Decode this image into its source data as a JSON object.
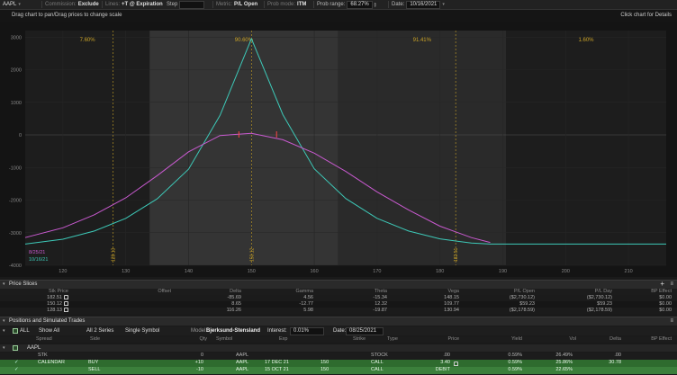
{
  "colors": {
    "expiration_curve": "#3dc9b8",
    "date_curve": "#c95ad0",
    "marker": "#c9a227",
    "strike_marker": "#ff4444",
    "green_row": "#2e6b2e"
  },
  "toolbar": {
    "symbol": "AAPL",
    "commission_label": "Commission:",
    "commission_value": "Exclude",
    "lines_label": "Lines:",
    "lines_value": "+T @ Expiration",
    "step_label": "Step",
    "step_value": "",
    "metric_label": "Metric:",
    "metric_value": "P/L Open",
    "prob_mode_label": "Prob mode:",
    "prob_mode_value": "ITM",
    "prob_range_label": "Prob range:",
    "prob_range_value": "68.27%",
    "date_label": "Date:",
    "date_value": "10/16/2021"
  },
  "hints": {
    "drag": "Drag chart to pan/Drag prices to change scale",
    "click": "Click chart for Details"
  },
  "chart_data": {
    "type": "line",
    "xlim": [
      114,
      216
    ],
    "ylim": [
      -4000,
      3200
    ],
    "x_ticks": [
      120,
      130,
      140,
      150,
      160,
      170,
      180,
      190,
      200,
      210
    ],
    "y_ticks": [
      3000,
      2000,
      1000,
      0,
      -1000,
      -2000,
      -3000,
      -4000
    ],
    "y_tick_labels": [
      "3000",
      "2000",
      "1000",
      "0",
      "-1000",
      "-2000",
      "-3000",
      "-4000"
    ],
    "zones": [
      {
        "from": 114,
        "to": 133.8,
        "label": "7.60%"
      },
      {
        "from": 133.8,
        "to": 163.8,
        "label": "90.60%"
      },
      {
        "from": 163.8,
        "to": 190.5,
        "label": "91.41%"
      },
      {
        "from": 190.5,
        "to": 216,
        "label": "1.60%"
      }
    ],
    "vlines": [
      {
        "x": 128,
        "label": "128.13"
      },
      {
        "x": 150,
        "label": "150.12"
      },
      {
        "x": 182.5,
        "label": "182.51"
      }
    ],
    "strike_markers": [
      {
        "x": 148,
        "y": 0
      },
      {
        "x": 154,
        "y": 0
      }
    ],
    "series": [
      {
        "name": "10/16/21",
        "x": [
          114,
          120,
          125,
          130,
          135,
          140,
          145,
          150,
          155,
          160,
          165,
          170,
          175,
          180,
          185,
          188,
          216
        ],
        "y": [
          -3350,
          -3200,
          -2950,
          -2560,
          -1960,
          -1050,
          600,
          2950,
          620,
          -1040,
          -1950,
          -2560,
          -2950,
          -3190,
          -3320,
          -3350,
          -3350
        ]
      },
      {
        "name": "8/25/21",
        "x": [
          114,
          120,
          125,
          130,
          135,
          140,
          145,
          150,
          155,
          160,
          165,
          170,
          175,
          180,
          185,
          188
        ],
        "y": [
          -3150,
          -2850,
          -2450,
          -1930,
          -1250,
          -520,
          -20,
          50,
          -150,
          -560,
          -1120,
          -1750,
          -2300,
          -2800,
          -3150,
          -3300
        ]
      }
    ]
  },
  "price_slices": {
    "title": "Price Slices",
    "columns": [
      "Stk Price",
      "Offset",
      "Delta",
      "Gamma",
      "Theta",
      "Vega",
      "P/L Open",
      "P/L Day",
      "BP Effect"
    ],
    "rows": [
      [
        "182.51",
        "",
        "-85.69",
        "4.56",
        "-15.34",
        "148.15",
        "($2,730.12)",
        "($2,730.12)",
        "$0.00"
      ],
      [
        "150.12",
        "",
        "8.65",
        "-12.77",
        "12.32",
        "109.77",
        "$59.23",
        "$59.23",
        "$0.00"
      ],
      [
        "128.13",
        "",
        "116.26",
        "5.98",
        "-19.87",
        "130.94",
        "($2,178.59)",
        "($2,178.59)",
        "$0.00"
      ]
    ]
  },
  "positions": {
    "title": "Positions and Simulated Trades",
    "toolbar": {
      "all_label": "ALL",
      "show_all": "Show All",
      "all_series": "All 2 Series",
      "single_symbol": "Single Symbol",
      "model_label": "Model:",
      "model_value": "Bjerksund-Stensland",
      "interest_label": "Interest:",
      "interest_value": "0.01%",
      "date_label": "Date:",
      "date_value": "08/25/2021"
    },
    "columns": [
      "Spread",
      "Side",
      "Qty",
      "Symbol",
      "Exp",
      "Strike",
      "Type",
      "Price",
      "Yield",
      "Vol",
      "Delta",
      "BP Effect"
    ],
    "group": "AAPL",
    "rows": [
      [
        "",
        "STK",
        "",
        "0",
        "AAPL",
        "",
        "",
        "STOCK",
        ".00",
        "0.59%",
        "26.49%",
        ".00"
      ],
      [
        "",
        "CALENDAR",
        "BUY",
        "+10",
        "AAPL",
        "17 DEC 21",
        "150",
        "CALL",
        "3.40",
        "0.59%",
        "25.86%",
        "30.78"
      ],
      [
        "",
        "",
        "SELL",
        "-10",
        "AAPL",
        "15 OCT 21",
        "150",
        "CALL",
        "DEBIT",
        "0.59%",
        "22.65%",
        ""
      ]
    ]
  }
}
